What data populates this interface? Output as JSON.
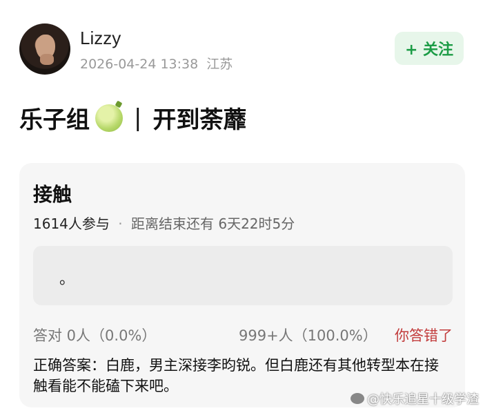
{
  "post": {
    "username": "Lizzy",
    "datetime": "2026-04-24 13:38",
    "location": "江苏",
    "follow_label": "+ 关注",
    "title_part1": "乐子组",
    "title_separator": "|",
    "title_part2": "开到荼蘼",
    "title_emoji": "melon-icon"
  },
  "quiz": {
    "title": "接触",
    "participants": "1614人参与",
    "dot": "·",
    "deadline": "距离结束还有 6天22时5分",
    "option_text": "。",
    "correct_stat": "答对  0人（0.0%）",
    "wrong_stat": "999+人（100.0%）",
    "wrong_label": "你答错了",
    "answer": "正确答案：白鹿，男主深接李昀锐。但白鹿还有其他转型本在接触看能不能磕下来吧。"
  },
  "watermark": {
    "text": "@快乐追星十级学渣"
  },
  "colors": {
    "follow_bg": "#e7f6ea",
    "follow_text": "#1c9c46",
    "wrong_text": "#c23b3b",
    "card_bg": "#f6f6f6"
  }
}
